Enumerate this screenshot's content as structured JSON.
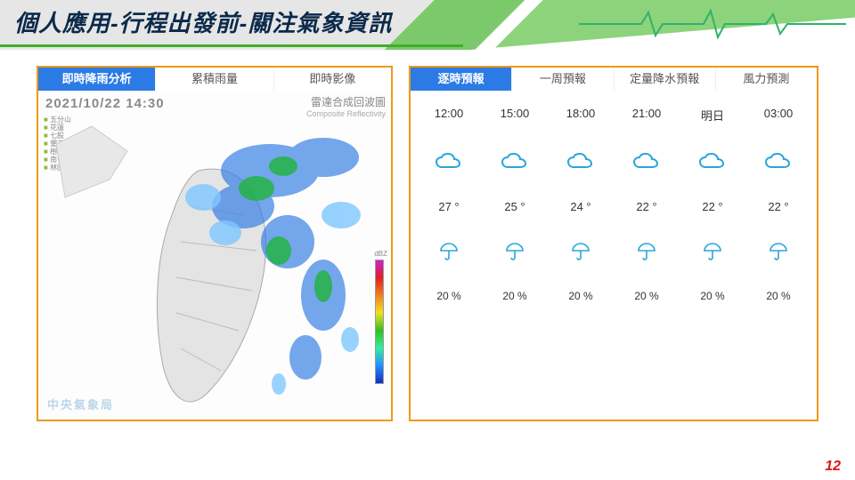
{
  "header": {
    "title": "個人應用-行程出發前-關注氣象資訊"
  },
  "page_number": "12",
  "radar_panel": {
    "tabs": [
      "即時降雨分析",
      "累積雨量",
      "即時影像"
    ],
    "active_tab_index": 0,
    "timestamp": "2021/10/22  14:30",
    "product_name_zh": "雷達合成回波圖",
    "product_name_en": "Composite Reflectivity",
    "scale_label": "dBZ",
    "source": "中央氣象局",
    "legend": [
      "五分山",
      "花蓮",
      "七股",
      "墾丁",
      "樹林",
      "南屯",
      "林園"
    ]
  },
  "forecast_panel": {
    "tabs": [
      "逐時預報",
      "一周預報",
      "定量降水預報",
      "風力預測"
    ],
    "active_tab_index": 0,
    "hours": [
      {
        "time": "12:00",
        "icon": "cloud",
        "temp": "27 °",
        "pop": "20 %"
      },
      {
        "time": "15:00",
        "icon": "cloud",
        "temp": "25 °",
        "pop": "20 %"
      },
      {
        "time": "18:00",
        "icon": "cloud",
        "temp": "24 °",
        "pop": "20 %"
      },
      {
        "time": "21:00",
        "icon": "cloud",
        "temp": "22 °",
        "pop": "20 %"
      },
      {
        "time": "明日",
        "icon": "cloud",
        "temp": "22 °",
        "pop": "20 %"
      },
      {
        "time": "03:00",
        "icon": "cloud",
        "temp": "22 °",
        "pop": "20 %"
      }
    ]
  }
}
